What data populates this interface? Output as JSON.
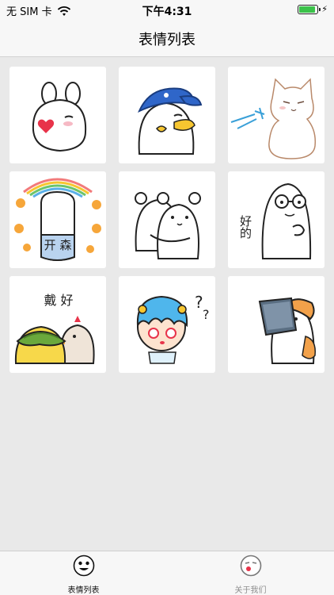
{
  "status_bar": {
    "carrier": "无 SIM 卡",
    "time": "下午4:31",
    "wifi_icon": "wifi-icon",
    "battery_color": "#3bc24a"
  },
  "navbar": {
    "title": "表情列表"
  },
  "grid": {
    "stickers": [
      {
        "name": "white-bunny-heart",
        "caption": ""
      },
      {
        "name": "duck-blue-cap",
        "caption": ""
      },
      {
        "name": "white-cat-splash",
        "caption": ""
      },
      {
        "name": "rainbow-happy",
        "caption": "开 森"
      },
      {
        "name": "bear-hug",
        "caption": ""
      },
      {
        "name": "glasses-guy-ok",
        "caption": "好的"
      },
      {
        "name": "chick-and-hen",
        "caption": "戴 好"
      },
      {
        "name": "blue-hair-confused",
        "caption": ""
      },
      {
        "name": "hamster-tablet",
        "caption": ""
      }
    ]
  },
  "tabbar": {
    "tabs": [
      {
        "label": "表情列表",
        "icon": "emoji-face-icon",
        "active": true
      },
      {
        "label": "关于我们",
        "icon": "emoji-face-icon",
        "active": false
      }
    ]
  }
}
